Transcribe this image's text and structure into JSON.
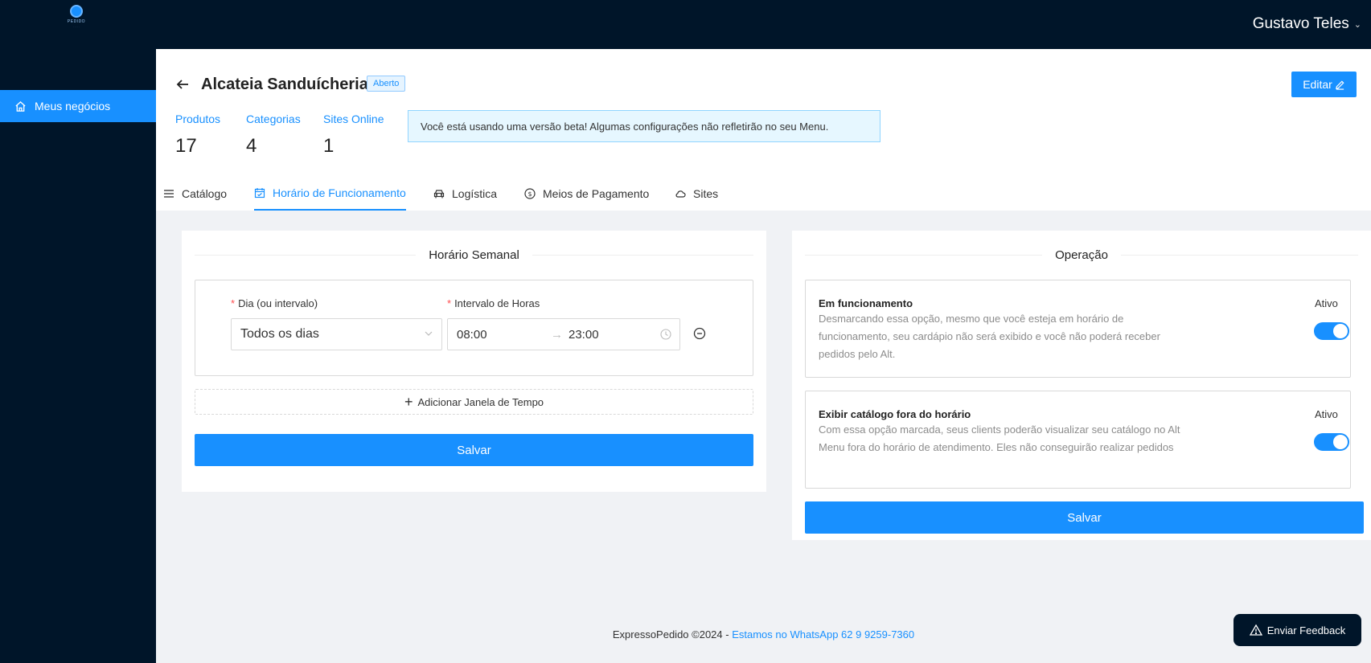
{
  "header": {
    "logo_text": "PEDIDO",
    "user_name": "Gustavo Teles"
  },
  "sidebar": {
    "items": [
      {
        "label": "Meus negócios",
        "icon": "home-icon"
      }
    ]
  },
  "business": {
    "title": "Alcateia Sanduícheria",
    "status_badge": "Aberto",
    "edit_label": "Editar"
  },
  "stats": [
    {
      "label": "Produtos",
      "value": "17"
    },
    {
      "label": "Categorias",
      "value": "4"
    },
    {
      "label": "Sites Online",
      "value": "1"
    }
  ],
  "beta_notice": "Você está usando uma versão beta! Algumas configurações não refletirão no seu Menu.",
  "tabs": [
    {
      "label": "Catálogo",
      "icon": "menu-icon",
      "active": false
    },
    {
      "label": "Horário de Funcionamento",
      "icon": "calendar-icon",
      "active": true
    },
    {
      "label": "Logística",
      "icon": "car-icon",
      "active": false
    },
    {
      "label": "Meios de Pagamento",
      "icon": "dollar-icon",
      "active": false
    },
    {
      "label": "Sites",
      "icon": "cloud-icon",
      "active": false
    }
  ],
  "weekly": {
    "title": "Horário Semanal",
    "day_label": "Dia (ou intervalo)",
    "hours_label": "Intervalo de Horas",
    "day_value": "Todos os dias",
    "start_time": "08:00",
    "end_time": "23:00",
    "add_window_label": "Adicionar Janela de Tempo",
    "save_label": "Salvar"
  },
  "operation": {
    "title": "Operação",
    "options": [
      {
        "title": "Em funcionamento",
        "description": "Desmarcando essa opção, mesmo que você esteja em horário de funcionamento, seu cardápio não será exibido e você não poderá receber pedidos pelo Alt.",
        "status": "Ativo",
        "enabled": true
      },
      {
        "title": "Exibir catálogo fora do horário",
        "description": "Com essa opção marcada, seus clients poderão visualizar seu catálogo no Alt Menu fora do horário de atendimento. Eles não conseguirão realizar pedidos",
        "status": "Ativo",
        "enabled": true
      }
    ],
    "save_label": "Salvar"
  },
  "footer": {
    "copyright": "ExpressoPedido ©2024 - ",
    "link": "Estamos no WhatsApp 62 9 9259-7360"
  },
  "feedback_label": "Enviar Feedback",
  "colors": {
    "primary": "#1890ff",
    "dark": "#001529"
  }
}
